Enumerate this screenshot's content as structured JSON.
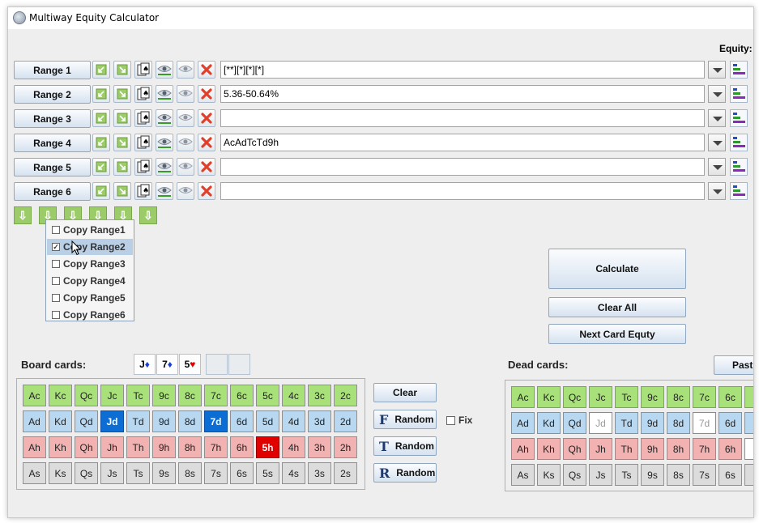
{
  "window": {
    "title": "Multiway Equity Calculator"
  },
  "equity_label": "Equity:",
  "ranges": [
    {
      "label": "Range 1",
      "value": "[**][*][*][*]"
    },
    {
      "label": "Range 2",
      "value": "5.36-50.64%"
    },
    {
      "label": "Range 3",
      "value": ""
    },
    {
      "label": "Range 4",
      "value": "AcAdTcTd9h"
    },
    {
      "label": "Range 5",
      "value": ""
    },
    {
      "label": "Range 6",
      "value": ""
    }
  ],
  "copy_menu": {
    "items": [
      {
        "label": "Copy Range1",
        "checked": false
      },
      {
        "label": "Copy Range2",
        "checked": true
      },
      {
        "label": "Copy Range3",
        "checked": false
      },
      {
        "label": "Copy Range4",
        "checked": false
      },
      {
        "label": "Copy Range5",
        "checked": false
      },
      {
        "label": "Copy Range6",
        "checked": false
      }
    ]
  },
  "actions": {
    "calculate": "Calculate",
    "clear_all": "Clear All",
    "next_card": "Next Card Equty"
  },
  "board": {
    "label": "Board cards:",
    "selected": [
      {
        "rank": "J",
        "suit": "♦"
      },
      {
        "rank": "7",
        "suit": "♦"
      },
      {
        "rank": "5",
        "suit": "♥"
      }
    ],
    "clear": "Clear",
    "random_f": "Random",
    "random_t": "Random",
    "random_r": "Random",
    "fix": "Fix",
    "grid": [
      [
        "Ac",
        "Kc",
        "Qc",
        "Jc",
        "Tc",
        "9c",
        "8c",
        "7c",
        "6c",
        "5c",
        "4c",
        "3c",
        "2c"
      ],
      [
        "Ad",
        "Kd",
        "Qd",
        "Jd",
        "Td",
        "9d",
        "8d",
        "7d",
        "6d",
        "5d",
        "4d",
        "3d",
        "2d"
      ],
      [
        "Ah",
        "Kh",
        "Qh",
        "Jh",
        "Th",
        "9h",
        "8h",
        "7h",
        "6h",
        "5h",
        "4h",
        "3h",
        "2h"
      ],
      [
        "As",
        "Ks",
        "Qs",
        "Js",
        "Ts",
        "9s",
        "8s",
        "7s",
        "6s",
        "5s",
        "4s",
        "3s",
        "2s"
      ]
    ]
  },
  "dead": {
    "label": "Dead cards:",
    "paste": "Past",
    "grid": [
      [
        "Ac",
        "Kc",
        "Qc",
        "Jc",
        "Tc",
        "9c",
        "8c",
        "7c",
        "6c"
      ],
      [
        "Ad",
        "Kd",
        "Qd",
        "Jd",
        "Td",
        "9d",
        "8d",
        "7d",
        "6d"
      ],
      [
        "Ah",
        "Kh",
        "Qh",
        "Jh",
        "Th",
        "9h",
        "8h",
        "7h",
        "6h"
      ],
      [
        "As",
        "Ks",
        "Qs",
        "Js",
        "Ts",
        "9s",
        "8s",
        "7s",
        "6s"
      ]
    ],
    "partial_col_row1": "5"
  },
  "colors": {
    "club": "#a8e07a",
    "diamond": "#b8d8f2",
    "heart": "#f2b2b2",
    "spade": "#dcdcdc",
    "selected_blue": "#0c6ed4",
    "selected_red": "#e10000"
  }
}
